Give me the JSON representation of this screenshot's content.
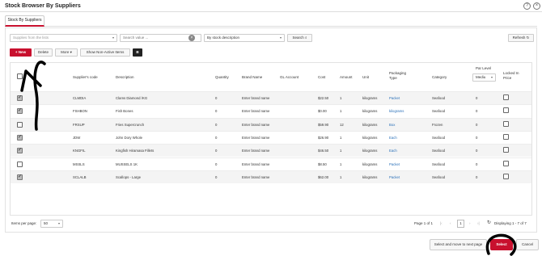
{
  "window": {
    "title": "Stock Browser By Suppliers"
  },
  "tabs": [
    {
      "label": "Stock By Suppliers"
    }
  ],
  "toolbar": {
    "supplier_placeholder": "Supplies from the lists",
    "search_placeholder": "Search value ...",
    "search_mode": "By stock description",
    "search_button": "Search",
    "refresh_button": "Refresh",
    "new_button": "New",
    "delete_button": "Delete",
    "more_button": "More",
    "show_inactive_button": "Show Non-Active Items",
    "b_button": "B"
  },
  "table": {
    "headers": {
      "code": "Supplier's code",
      "description": "Description",
      "quantity": "Quantity",
      "brand": "Brand Name",
      "gl": "GL Account",
      "cost": "Cost",
      "amount": "Amount",
      "unit": "Unit",
      "packaging": "Packaging Type",
      "category": "Category",
      "par_level": "Par Level",
      "par_select": "Mediu",
      "locked": "Locked In Price"
    },
    "rows": [
      {
        "checked": true,
        "code": "CLMDIA",
        "description": "Clams Diamond /KG",
        "quantity": "0",
        "brand": "Enter brand name",
        "cost": "$22.50",
        "amount": "1",
        "unit": "kilograms",
        "packaging": "Packet",
        "category": "Seafood",
        "par": "0"
      },
      {
        "checked": true,
        "code": "FSHBON",
        "description": "Fish Bones",
        "quantity": "0",
        "brand": "Enter brand name",
        "cost": "$0.00",
        "amount": "1",
        "unit": "kilograms",
        "packaging": "kilograms",
        "category": "Seafood",
        "par": "0"
      },
      {
        "checked": false,
        "code": "FRSUP",
        "description": "Fries Supercrunch",
        "quantity": "0",
        "brand": "Enter brand name",
        "cost": "$59.90",
        "amount": "12",
        "unit": "kilograms",
        "packaging": "Box",
        "category": "Frozen",
        "par": "0"
      },
      {
        "checked": true,
        "code": "JDW",
        "description": "John Dory Whole",
        "quantity": "0",
        "brand": "Enter brand name",
        "cost": "$26.90",
        "amount": "1",
        "unit": "kilograms",
        "packaging": "Each",
        "category": "Seafood",
        "par": "0"
      },
      {
        "checked": true,
        "code": "KNGFIL",
        "description": "Kingfish Hiramasa Fillets",
        "quantity": "0",
        "brand": "Enter brand name",
        "cost": "$46.50",
        "amount": "1",
        "unit": "kilograms",
        "packaging": "Each",
        "category": "Seafood",
        "par": "0"
      },
      {
        "checked": false,
        "code": "MSSLS",
        "description": "MUSSELS 1K",
        "quantity": "0",
        "brand": "Enter brand name",
        "cost": "$8.50",
        "amount": "1",
        "unit": "kilograms",
        "packaging": "Packet",
        "category": "Seafood",
        "par": "0"
      },
      {
        "checked": true,
        "code": "SCLALB",
        "description": "Scallops - Large",
        "quantity": "0",
        "brand": "Enter brand name",
        "cost": "$62.00",
        "amount": "1",
        "unit": "kilograms",
        "packaging": "Packet",
        "category": "Seafood",
        "par": "0"
      }
    ]
  },
  "pager": {
    "items_per_page_label": "Items per page:",
    "items_per_page": "50",
    "page_info": "Page 1 of 1",
    "current_page": "1",
    "display_info": "Displaying 1 - 7 of 7"
  },
  "footer": {
    "select_next": "Select and move to next page",
    "select": "Select",
    "cancel": "Cancel"
  },
  "colors": {
    "accent": "#c8102e",
    "link": "#2a70b8"
  }
}
